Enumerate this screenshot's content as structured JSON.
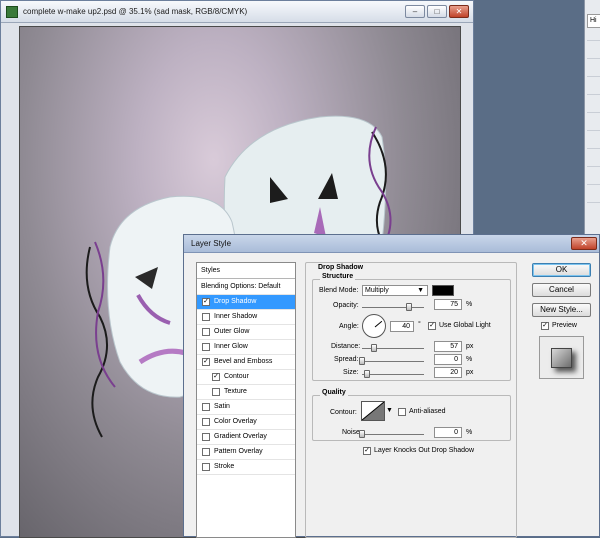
{
  "document": {
    "title": "complete w-make up2.psd @ 35.1% (sad mask, RGB/8/CMYK)",
    "minimize_glyph": "–",
    "maximize_glyph": "□",
    "close_glyph": "✕"
  },
  "right_panel": {
    "tab_label": "Hi"
  },
  "dialog": {
    "title": "Layer Style",
    "close_glyph": "✕",
    "styles_header": "Styles",
    "styles": [
      {
        "label": "Blending Options: Default",
        "checked": null,
        "selected": false
      },
      {
        "label": "Drop Shadow",
        "checked": true,
        "selected": true
      },
      {
        "label": "Inner Shadow",
        "checked": false,
        "selected": false
      },
      {
        "label": "Outer Glow",
        "checked": false,
        "selected": false
      },
      {
        "label": "Inner Glow",
        "checked": false,
        "selected": false
      },
      {
        "label": "Bevel and Emboss",
        "checked": true,
        "selected": false
      },
      {
        "label": "Contour",
        "checked": true,
        "selected": false
      },
      {
        "label": "Texture",
        "checked": false,
        "selected": false
      },
      {
        "label": "Satin",
        "checked": false,
        "selected": false
      },
      {
        "label": "Color Overlay",
        "checked": false,
        "selected": false
      },
      {
        "label": "Gradient Overlay",
        "checked": false,
        "selected": false
      },
      {
        "label": "Pattern Overlay",
        "checked": false,
        "selected": false
      },
      {
        "label": "Stroke",
        "checked": false,
        "selected": false
      }
    ],
    "section_title": "Drop Shadow",
    "structure": {
      "title": "Structure",
      "blend_mode_label": "Blend Mode:",
      "blend_mode_value": "Multiply",
      "blend_color": "#000000",
      "opacity_label": "Opacity:",
      "opacity_value": "75",
      "opacity_unit": "%",
      "opacity_fraction": 0.75,
      "angle_label": "Angle:",
      "angle_value": "40",
      "angle_unit": "°",
      "use_global_light_label": "Use Global Light",
      "use_global_light": true,
      "distance_label": "Distance:",
      "distance_value": "57",
      "distance_unit": "px",
      "distance_fraction": 0.19,
      "spread_label": "Spread:",
      "spread_value": "0",
      "spread_unit": "%",
      "spread_fraction": 0,
      "size_label": "Size:",
      "size_value": "20",
      "size_unit": "px",
      "size_fraction": 0.08
    },
    "quality": {
      "title": "Quality",
      "contour_label": "Contour:",
      "anti_aliased_label": "Anti-aliased",
      "anti_aliased": false,
      "noise_label": "Noise:",
      "noise_value": "0",
      "noise_unit": "%",
      "noise_fraction": 0
    },
    "knockout_label": "Layer Knocks Out Drop Shadow",
    "knockout": true,
    "buttons": {
      "ok": "OK",
      "cancel": "Cancel",
      "new_style": "New Style...",
      "preview": "Preview"
    },
    "preview_checked": true
  }
}
